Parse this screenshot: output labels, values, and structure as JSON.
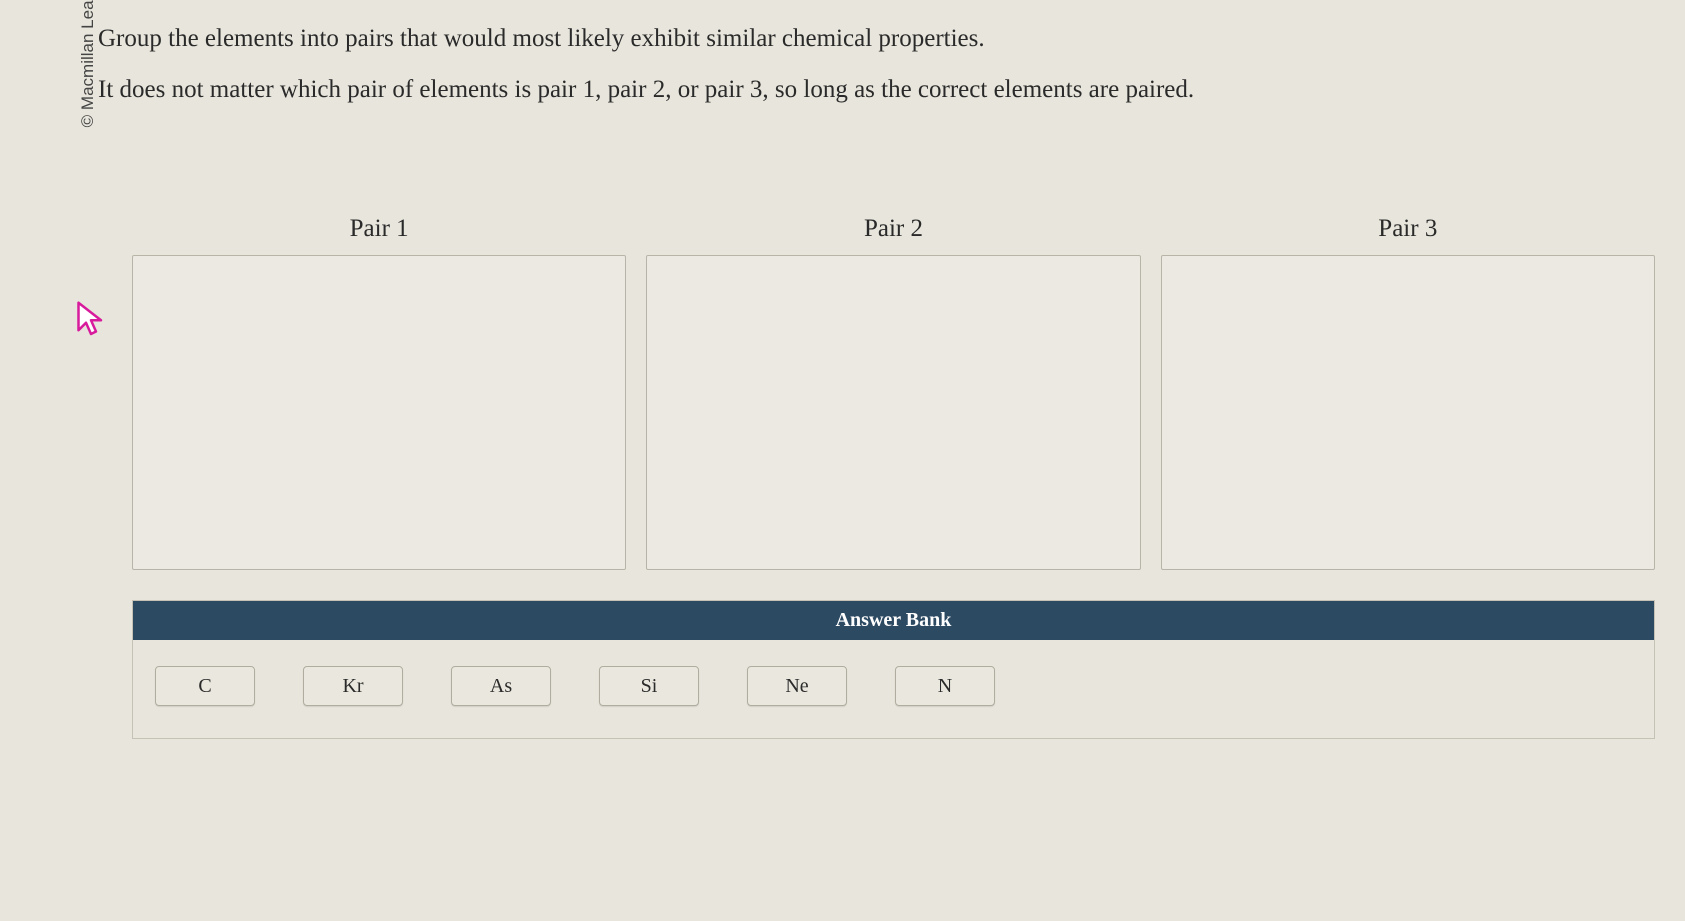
{
  "copyright": "© Macmillan Learning",
  "question": {
    "line1": "Group the elements into pairs that would most likely exhibit similar chemical properties.",
    "line2": "It does not matter which pair of elements is pair 1, pair 2, or pair 3, so long as the correct elements are paired."
  },
  "pairs": [
    {
      "label": "Pair 1"
    },
    {
      "label": "Pair 2"
    },
    {
      "label": "Pair 3"
    }
  ],
  "answerBank": {
    "title": "Answer Bank",
    "items": [
      "C",
      "Kr",
      "As",
      "Si",
      "Ne",
      "N"
    ]
  }
}
